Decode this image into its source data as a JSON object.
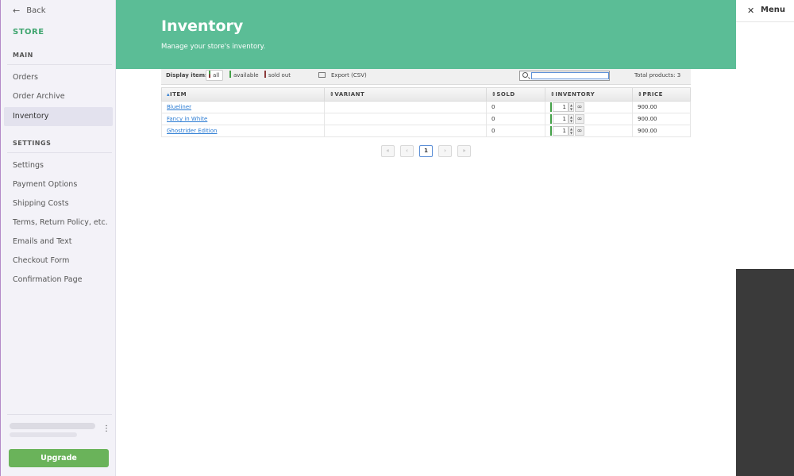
{
  "sidebar": {
    "back_label": "Back",
    "store_label": "STORE",
    "sections": {
      "main": "MAIN",
      "settings": "SETTINGS"
    },
    "main_items": [
      "Orders",
      "Order Archive",
      "Inventory"
    ],
    "settings_items": [
      "Settings",
      "Payment Options",
      "Shipping Costs",
      "Terms, Return Policy, etc.",
      "Emails and Text",
      "Checkout Form",
      "Confirmation Page"
    ],
    "active_item": "Inventory",
    "upgrade_label": "Upgrade"
  },
  "header": {
    "title": "Inventory",
    "subtitle": "Manage your store's inventory."
  },
  "toolbar": {
    "display_label": "Display items:",
    "filter_all": "all",
    "filter_available": "available",
    "filter_sold_out": "sold out",
    "export_label": "Export (CSV)",
    "search_value": "",
    "total_label": "Total products: 3"
  },
  "table": {
    "headers": [
      "ITEM",
      "VARIANT",
      "SOLD",
      "INVENTORY",
      "PRICE"
    ],
    "rows": [
      {
        "item": "Blueliner",
        "variant": "",
        "sold": "0",
        "inventory": "1",
        "price": "900.00"
      },
      {
        "item": "Fancy in White",
        "variant": "",
        "sold": "0",
        "inventory": "1",
        "price": "900.00"
      },
      {
        "item": "Ghostrider Edition",
        "variant": "",
        "sold": "0",
        "inventory": "1",
        "price": "900.00"
      }
    ]
  },
  "pagination": {
    "first": "«",
    "prev": "‹",
    "current": "1",
    "next": "›",
    "last": "»"
  },
  "right_panel": {
    "menu_label": "Menu"
  },
  "colors": {
    "accent_green": "#5bbd96",
    "store_green": "#3fa56f",
    "upgrade_green": "#6ab35a",
    "link_blue": "#2a7bd3",
    "available_bar": "#43a047",
    "sold_out_bar": "#8b3a3a"
  },
  "icons": {
    "back": "arrow-left-icon",
    "kebab": "kebab-menu-icon",
    "export": "export-icon",
    "search": "search-icon",
    "sort": "sort-icon",
    "infinity": "infinity-icon",
    "close": "close-icon"
  }
}
